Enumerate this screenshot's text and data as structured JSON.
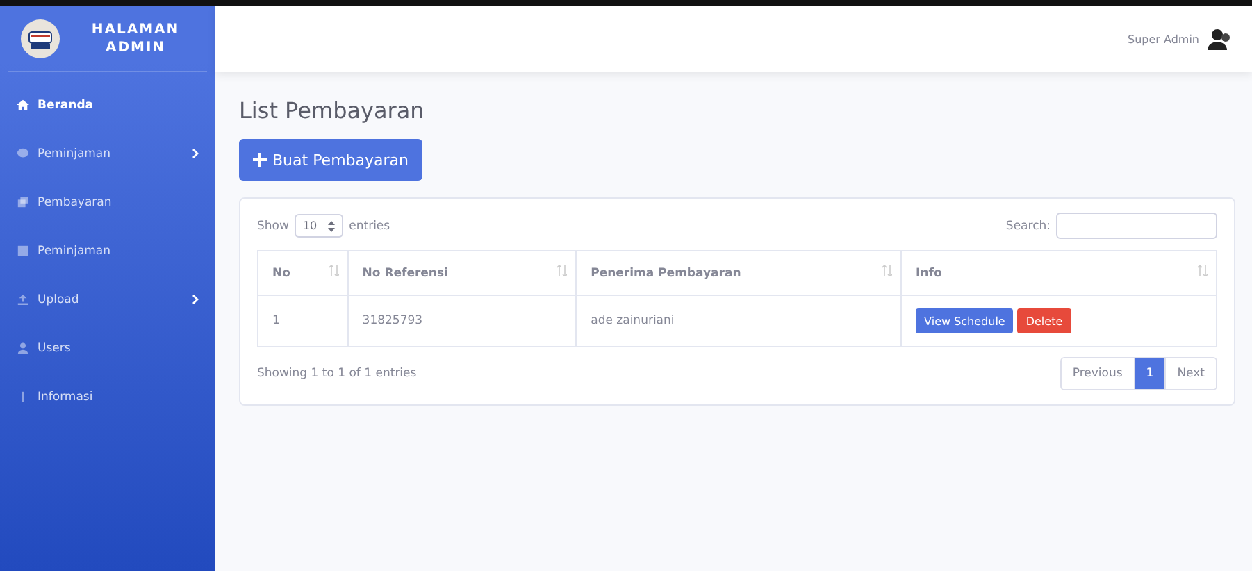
{
  "brand": {
    "title_line1": "HALAMAN",
    "title_line2": "ADMIN"
  },
  "sidebar": {
    "items": [
      {
        "label": "Beranda",
        "selected": true,
        "has_submenu": false
      },
      {
        "label": "Peminjaman",
        "selected": false,
        "has_submenu": true
      },
      {
        "label": "Pembayaran",
        "selected": false,
        "has_submenu": false
      },
      {
        "label": "Peminjaman",
        "selected": false,
        "has_submenu": false
      },
      {
        "label": "Upload",
        "selected": false,
        "has_submenu": true
      },
      {
        "label": "Users",
        "selected": false,
        "has_submenu": false
      },
      {
        "label": "Informasi",
        "selected": false,
        "has_submenu": false
      }
    ]
  },
  "topbar": {
    "user": "Super Admin"
  },
  "page_title": "List Pembayaran",
  "create_button": "Buat Pembayaran",
  "table_controls": {
    "show_label": "Show",
    "page_size": "10",
    "entries_label": "entries",
    "search_label": "Search:"
  },
  "table": {
    "columns": [
      "No",
      "No Referensi",
      "Penerima Pembayaran",
      "Info"
    ],
    "rows": [
      {
        "no": "1",
        "reference": "31825793",
        "recipient": "ade zainuriani",
        "actions": [
          "View Schedule",
          "Delete"
        ]
      }
    ]
  },
  "footer_info": "Showing 1 to 1 of 1 entries",
  "pagination": [
    {
      "label": "Previous",
      "selected": false
    },
    {
      "label": "1",
      "selected": true
    },
    {
      "label": "Next",
      "selected": false
    }
  ]
}
